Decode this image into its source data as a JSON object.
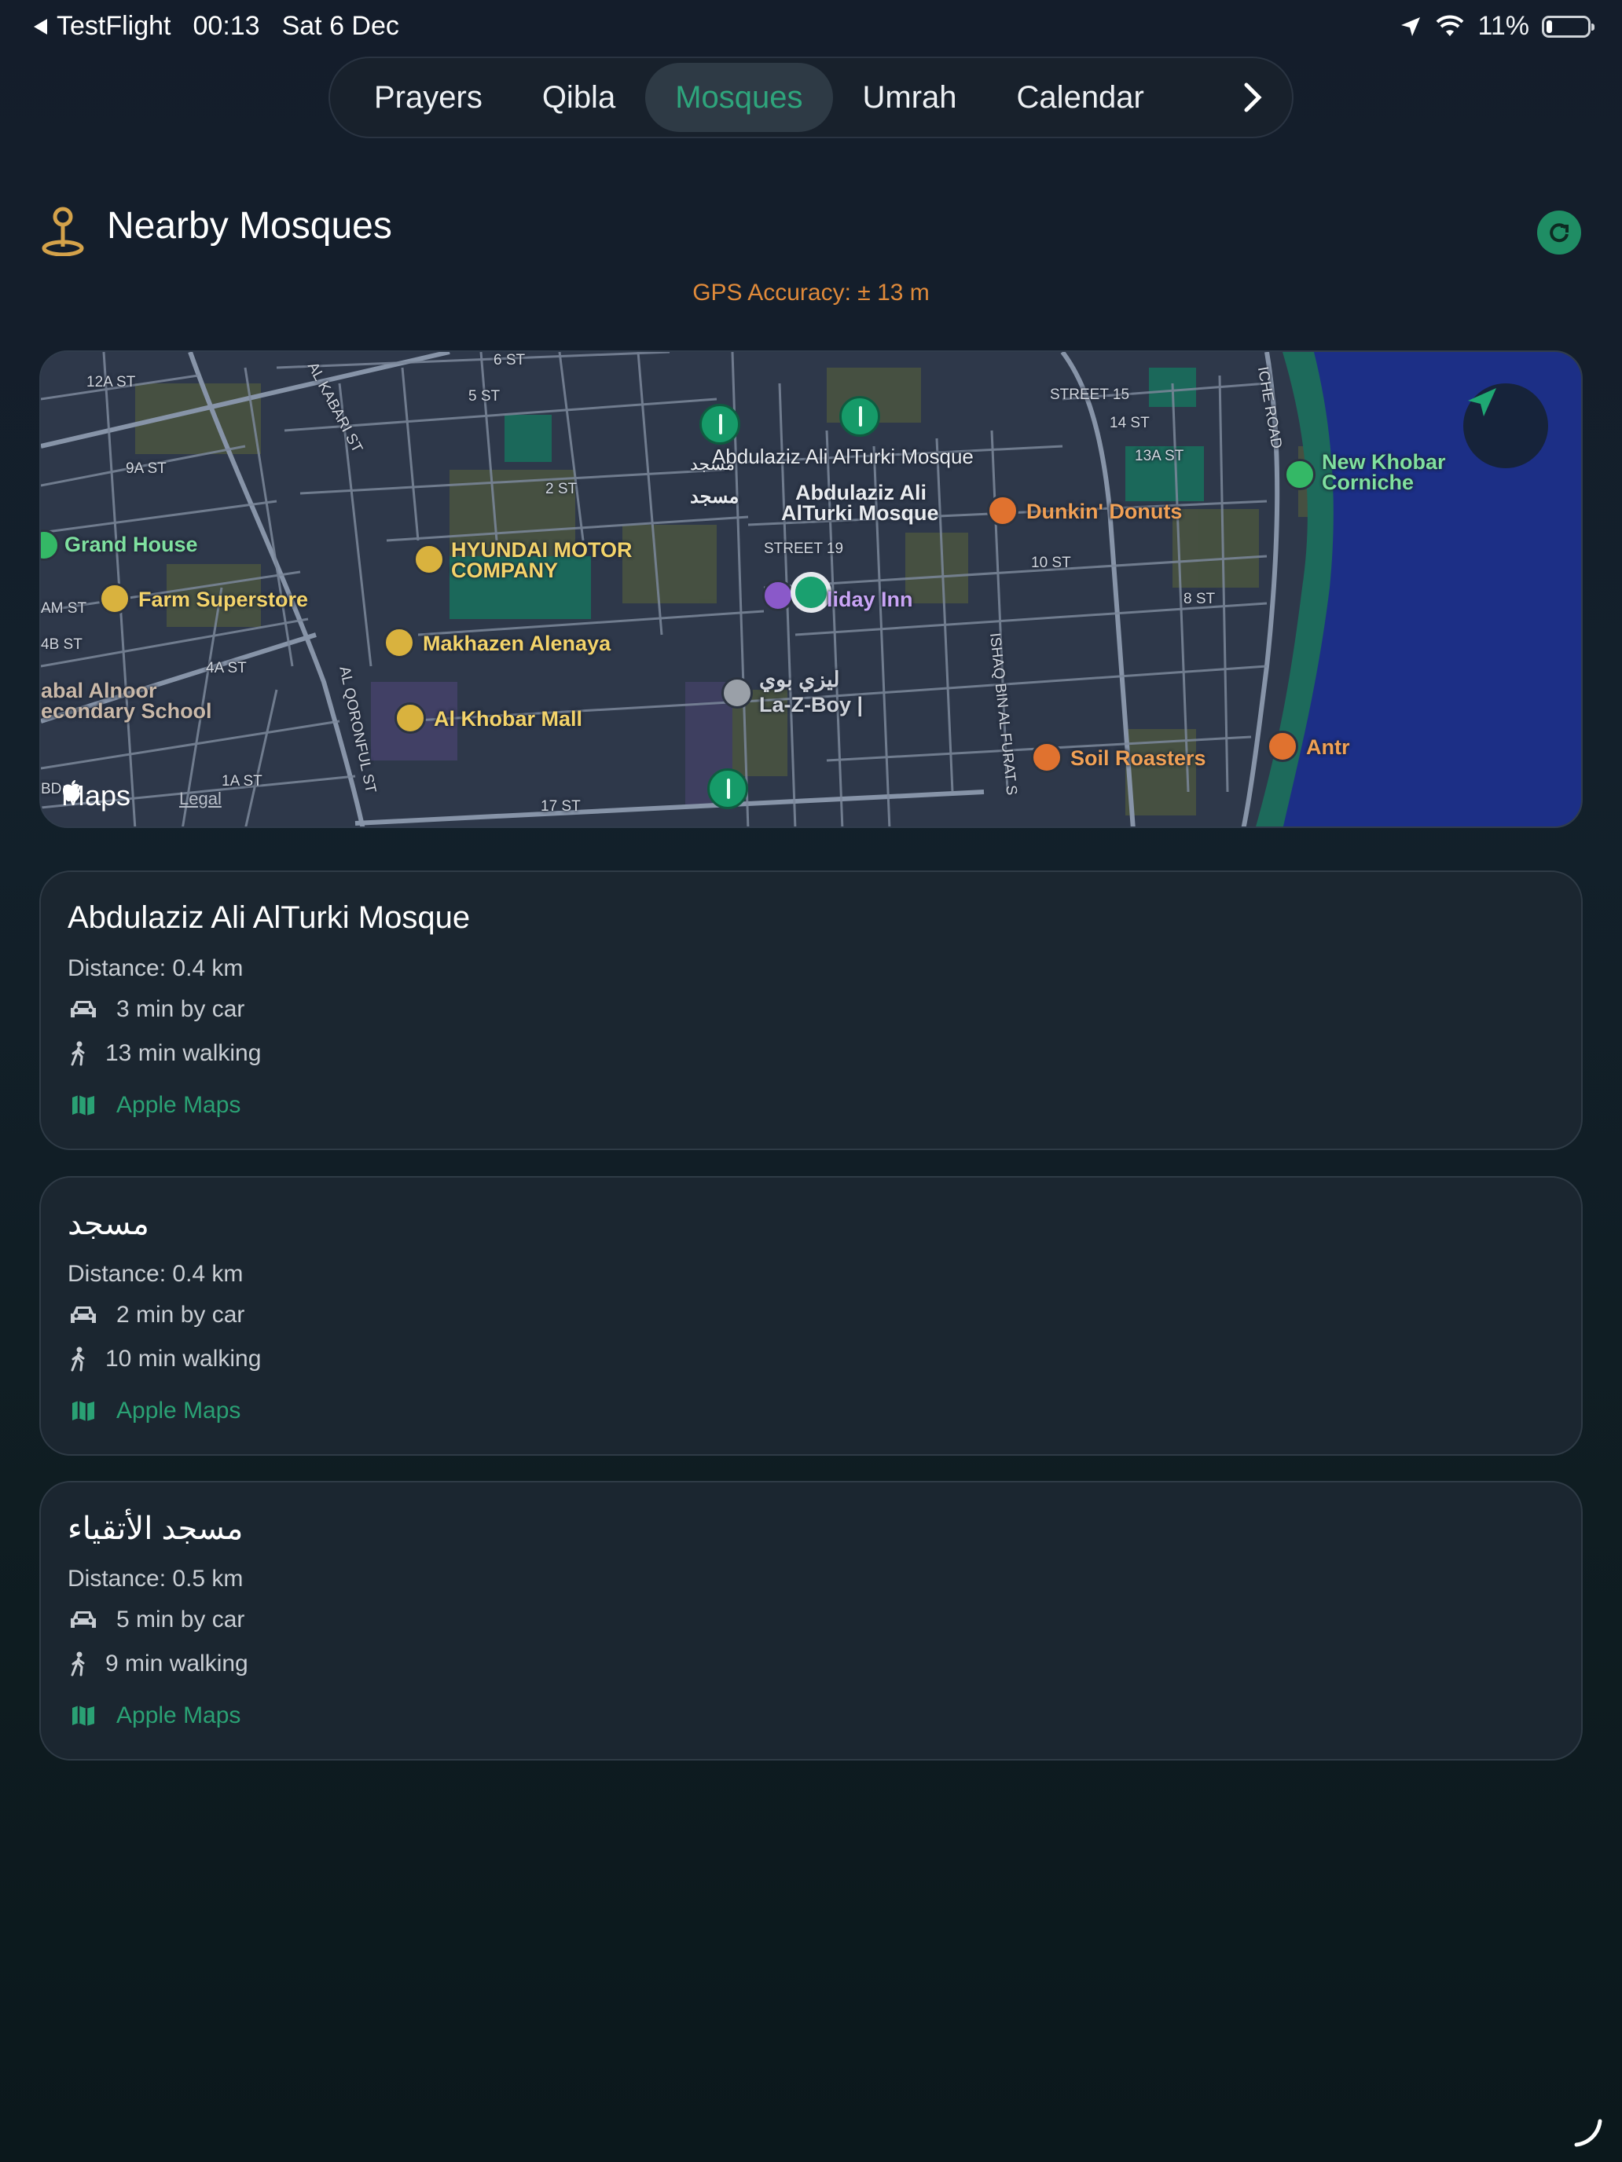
{
  "status_bar": {
    "back_app": "TestFlight",
    "time": "00:13",
    "date": "Sat 6 Dec",
    "battery": "11%"
  },
  "tabs": [
    {
      "label": "Prayers",
      "active": false
    },
    {
      "label": "Qibla",
      "active": false
    },
    {
      "label": "Mosques",
      "active": true
    },
    {
      "label": "Umrah",
      "active": false
    },
    {
      "label": "Calendar",
      "active": false
    }
  ],
  "header": {
    "title": "Nearby Mosques",
    "gps_accuracy": "GPS Accuracy: ± 13 m"
  },
  "map": {
    "labels": {
      "grand_house": "Grand House",
      "farm_superstore": "Farm Superstore",
      "hyundai": "HYUNDAI MOTOR",
      "hyundai2": "COMPANY",
      "makhazen": "Makhazen Alenaya",
      "khobar_mall": "Al Khobar Mall",
      "school1": "abal Alnoor",
      "school2": "econdary School",
      "mosque_small": "Abdulaziz Ali AlTurki Mosque",
      "masjid1": "مسجد",
      "masjid2": "مسجد",
      "mosque_bold1": "Abdulaziz Ali",
      "mosque_bold2": "AlTurki Mosque",
      "dunkin": "Dunkin' Donuts",
      "holiday": "liday Inn",
      "lazboy_ar": "ليزي بوي",
      "lazboy": "La-Z-Boy |",
      "soil": "Soil Roasters",
      "antr": "Antr",
      "corniche1": "New Khobar",
      "corniche2": "Corniche",
      "st_12a": "12A ST",
      "st_9a": "9A ST",
      "st_am": "AM ST",
      "st_4b": "4B ST",
      "st_4a": "4A ST",
      "st_1a": "1A ST",
      "st_6": "6 ST",
      "st_5": "5 ST",
      "st_2": "2 ST",
      "st_17": "17 ST",
      "st_19": "STREET 19",
      "st_10": "10 ST",
      "st_8": "8 ST",
      "st_13a": "13A ST",
      "st_14": "14 ST",
      "st_15": "STREET 15",
      "kabari": "AL KABARI ST",
      "qoronful": "AL QORONFUL ST",
      "ishaq": "ISHAQ BIN AL FURAT S",
      "corniche_rd": "ICHE ROAD",
      "bd": "BD"
    },
    "brand": "Maps",
    "legal": "Legal"
  },
  "mosques": [
    {
      "name": "Abdulaziz Ali AlTurki Mosque",
      "distance": "Distance: 0.4 km",
      "car": "3 min by car",
      "walk": "13 min walking",
      "maps_link": "Apple Maps"
    },
    {
      "name": "مسجد",
      "distance": "Distance: 0.4 km",
      "car": "2 min by car",
      "walk": "10 min walking",
      "maps_link": "Apple Maps"
    },
    {
      "name": "مسجد الأتقياء",
      "distance": "Distance: 0.5 km",
      "car": "5 min by car",
      "walk": "9 min walking",
      "maps_link": "Apple Maps"
    }
  ],
  "colors": {
    "accent": "#2ea57c",
    "gps": "#e08a3a"
  }
}
